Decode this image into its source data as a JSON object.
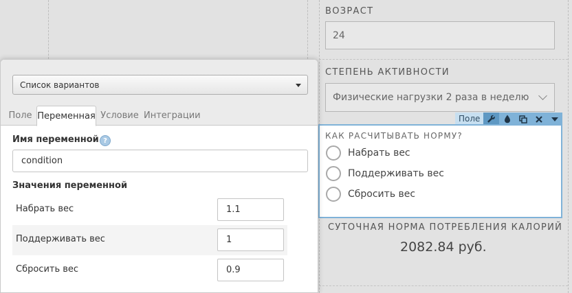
{
  "canvas": {
    "age_label": "ВОЗРАСТ",
    "age_value": "24",
    "activity_label": "СТЕПЕНЬ АКТИВНОСТИ",
    "activity_value": "Физические нагрузки 2 раза в неделю",
    "selected_field": {
      "question": "КАК РАСЧИТЫВАТЬ НОРМУ?",
      "options": [
        "Набрать вес",
        "Поддерживать вес",
        "Сбросить вес"
      ],
      "toolbar_label": "Поле",
      "toolbar_icons": [
        "wrench-icon",
        "drop-icon",
        "copy-icon",
        "close-icon",
        "caret-down-icon"
      ]
    },
    "result_title": "СУТОЧНАЯ НОРМА ПОТРЕБЛЕНИЯ КАЛОРИЙ",
    "result_value": "2082.84 руб."
  },
  "panel": {
    "type_select": "Список вариантов",
    "tabs": [
      "Поле",
      "Переменная",
      "Условие",
      "Интеграции"
    ],
    "active_tab": "Переменная",
    "var_name_label": "Имя переменной",
    "help_glyph": "?",
    "var_name_value": "condition",
    "values_label": "Значения переменной",
    "rows": [
      {
        "name": "Набрать вес",
        "value": "1.1"
      },
      {
        "name": "Поддерживать вес",
        "value": "1"
      },
      {
        "name": "Сбросить вес",
        "value": "0.9"
      }
    ]
  },
  "colors": {
    "selection_border": "#7fb2d8",
    "toolbar_active": "#5e98c3",
    "canvas_bg": "#e2e2e2"
  }
}
